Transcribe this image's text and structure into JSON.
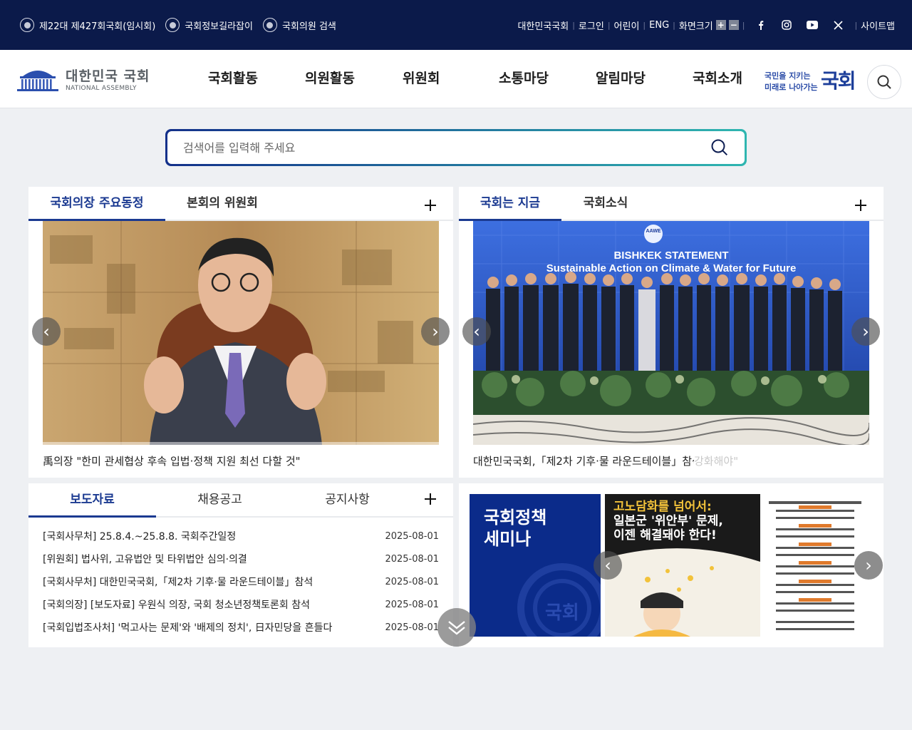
{
  "topbar": {
    "links_left": [
      "제22대 제427회국회(임시회)",
      "국회정보길라잡이",
      "국회의원 검색"
    ],
    "links_right": [
      "대한민국국회",
      "로그인",
      "어린이",
      "ENG",
      "화면크기"
    ],
    "font_plus": "+",
    "font_minus": "−",
    "sitemap": "사이트맵"
  },
  "header": {
    "logo_ko": "대한민국 국회",
    "logo_en": "NATIONAL ASSEMBLY",
    "nav": [
      "국회활동",
      "의원활동",
      "위원회",
      "소통마당",
      "알림마당",
      "국회소개"
    ],
    "slogan_line1": "국민을 지키는",
    "slogan_line2": "미래로 나아가는",
    "slogan_word": "국회"
  },
  "search": {
    "placeholder": "검색어를 입력해 주세요"
  },
  "panel_speaker": {
    "tabs": [
      "국회의장 주요동정",
      "본회의 위원회"
    ],
    "caption": "禹의장 \"한미 관세협상 후속 입법·정책 지원 최선 다할 것\""
  },
  "panel_now": {
    "tabs": [
      "국회는 지금",
      "국회소식"
    ],
    "banner_badge": "AAWE",
    "banner_title": "BISHKEK STATEMENT",
    "banner_subtitle": "Sustainable Action on Climate & Water for Future",
    "caption": "대한민국국회,「제2차 기후·물 라운드테이블」참석",
    "caption_ghost": "강화해야\""
  },
  "panel_press": {
    "tabs": [
      "보도자료",
      "채용공고",
      "공지사항"
    ],
    "items": [
      {
        "title": "[국회사무처] 25.8.4.~25.8.8. 국회주간일정",
        "date": "2025-08-01"
      },
      {
        "title": "[위원회] 법사위, 고유법안 및 타위법안 심의·의결",
        "date": "2025-08-01"
      },
      {
        "title": "[국회사무처] 대한민국국회,「제2차 기후·물 라운드테이블」참석",
        "date": "2025-08-01"
      },
      {
        "title": "[국회의장] [보도자료] 우원식 의장, 국회 청소년정책토론회 참석",
        "date": "2025-08-01"
      },
      {
        "title": "[국회입법조사처] '먹고사는 문제'와 '배제의 정치', 日자민당을 흔들다",
        "date": "2025-08-01"
      }
    ]
  },
  "panel_seminar": {
    "title_line1": "국회정책",
    "title_line2": "세미나",
    "watermark": "국회",
    "poster_title_line1": "고노담화를 넘어서:",
    "poster_title_line2": "일본군 '위안부' 문제,",
    "poster_title_line3": "이젠 해결돼야 한다!"
  },
  "colors": {
    "topbar": "#0b1a4a",
    "accent": "#1b3a91",
    "search_gradient_end": "#2fb6b0",
    "seminar": "#0b2b8a"
  }
}
